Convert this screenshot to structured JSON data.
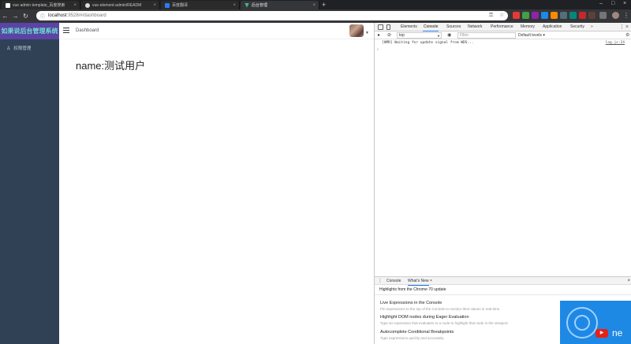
{
  "browser": {
    "tabs": [
      {
        "label": "vue admin template_百度搜索",
        "favicon_color": "#ffffff",
        "active": false
      },
      {
        "label": "vue-element-admin/READM",
        "favicon_color": "#dddddd",
        "active": false
      },
      {
        "label": "百度翻译",
        "favicon_color": "#2a7cf6",
        "active": false
      },
      {
        "label": "后台管理",
        "favicon_color": "#41b883",
        "active": true
      }
    ],
    "tab_close_glyph": "×",
    "new_tab_glyph": "+",
    "url_host": "localhost",
    "url_rest": ":9528/#/dashboard",
    "window_controls": [
      "–",
      "□",
      "×"
    ]
  },
  "app": {
    "logo_text": "如果说后台管理系统",
    "menu": [
      {
        "label": "权限管理",
        "icon": "user-icon"
      }
    ],
    "breadcrumb": "Dashboard",
    "dashboard_text": "name:测试用户"
  },
  "devtools": {
    "tabs": [
      "Elements",
      "Console",
      "Sources",
      "Network",
      "Performance",
      "Memory",
      "Application",
      "Security"
    ],
    "active_tab": "Console",
    "more_glyph": "»",
    "context": "top",
    "filter_placeholder": "Filter",
    "levels": "Default levels ▾",
    "log_message": "[HMR] Waiting for update signal from WDS...",
    "log_source": "log.js:24",
    "prompt_glyph": "›",
    "drawer": {
      "tabs": [
        "Console",
        "What's New"
      ],
      "active_tab": "What's New",
      "close_glyph": "×",
      "header": "Highlights from the Chrome 70 update",
      "items": [
        {
          "title": "Live Expressions in the Console",
          "desc": "Pin expressions to the top of the Console to monitor their values in real-time."
        },
        {
          "title": "Highlight DOM nodes during Eager Evaluation",
          "desc": "Type an expression that evaluates to a node to highlight that node in the viewport."
        },
        {
          "title": "Autocomplete Conditional Breakpoints",
          "desc": "Type expressions quickly and accurately."
        }
      ],
      "video_text": "ne"
    }
  }
}
